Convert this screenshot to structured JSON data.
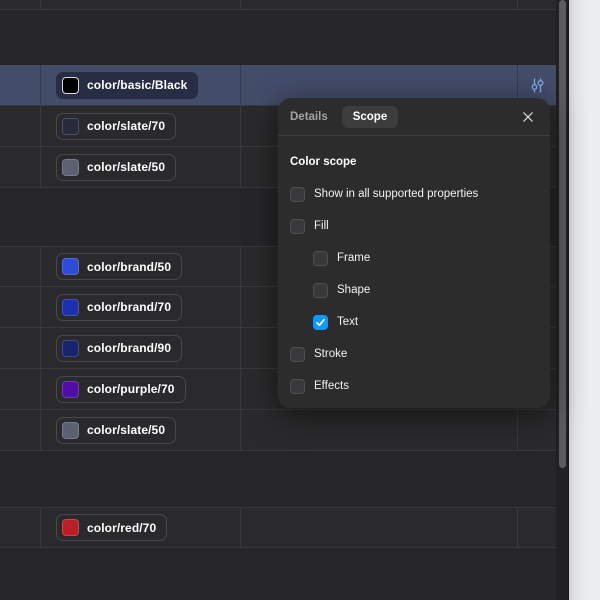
{
  "table": {
    "rows": [
      {
        "label": "color/basic/Black",
        "swatch": "#000000",
        "selected": true,
        "light_swatch_border": true
      },
      {
        "label": "color/slate/70",
        "swatch": "#262b3c"
      },
      {
        "label": "color/slate/50",
        "swatch": "#5a6173"
      },
      {
        "label": "color/brand/50",
        "swatch": "#2d4bd4"
      },
      {
        "label": "color/brand/70",
        "swatch": "#1c2fae"
      },
      {
        "label": "color/brand/90",
        "swatch": "#18246e"
      },
      {
        "label": "color/purple/70",
        "swatch": "#520da5"
      },
      {
        "label": "color/slate/50",
        "swatch": "#5a6173"
      },
      {
        "label": "color/red/70",
        "swatch": "#ba1f28"
      }
    ],
    "selected_row_color": "#434c69",
    "row_action_icon_color": "#7fadf2"
  },
  "popup": {
    "tabs": [
      {
        "label": "Details",
        "active": false
      },
      {
        "label": "Scope",
        "active": true
      }
    ],
    "title": "Color scope",
    "options": [
      {
        "label": "Show in all supported properties",
        "checked": false,
        "indent": 0
      },
      {
        "label": "Fill",
        "checked": false,
        "indent": 0
      },
      {
        "label": "Frame",
        "checked": false,
        "indent": 1
      },
      {
        "label": "Shape",
        "checked": false,
        "indent": 1
      },
      {
        "label": "Text",
        "checked": true,
        "indent": 1
      },
      {
        "label": "Stroke",
        "checked": false,
        "indent": 0
      },
      {
        "label": "Effects",
        "checked": false,
        "indent": 0
      }
    ],
    "checkbox_accent": "#0d99ff"
  },
  "icons": {
    "row_action": "sliders-icon",
    "close": "close-icon",
    "checked_option": "check-icon"
  }
}
